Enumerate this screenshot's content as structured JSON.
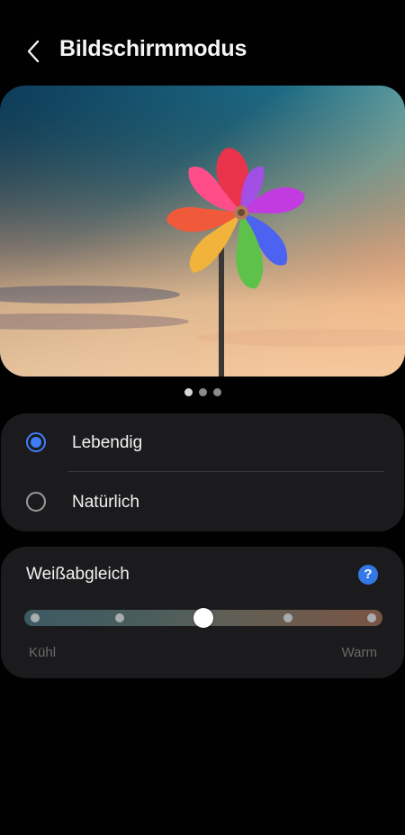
{
  "header": {
    "back_icon": "chevron-left-icon",
    "title": "Bildschirmmodus"
  },
  "preview": {
    "image": "pinwheel-sky-photo",
    "page_count": 3,
    "active_page": 1
  },
  "screen_modes": {
    "options": [
      {
        "label": "Lebendig",
        "selected": true
      },
      {
        "label": "Natürlich",
        "selected": false
      }
    ]
  },
  "white_balance": {
    "title": "Weißabgleich",
    "help_icon": "question-mark-icon",
    "help_symbol": "?",
    "steps": 5,
    "value_step": 3,
    "min_label": "Kühl",
    "max_label": "Warm"
  },
  "colors": {
    "background": "#010101",
    "card": "#1b1b1d",
    "accent": "#3f7df7",
    "help": "#3478e6",
    "muted_text": "#6a6a6a"
  }
}
